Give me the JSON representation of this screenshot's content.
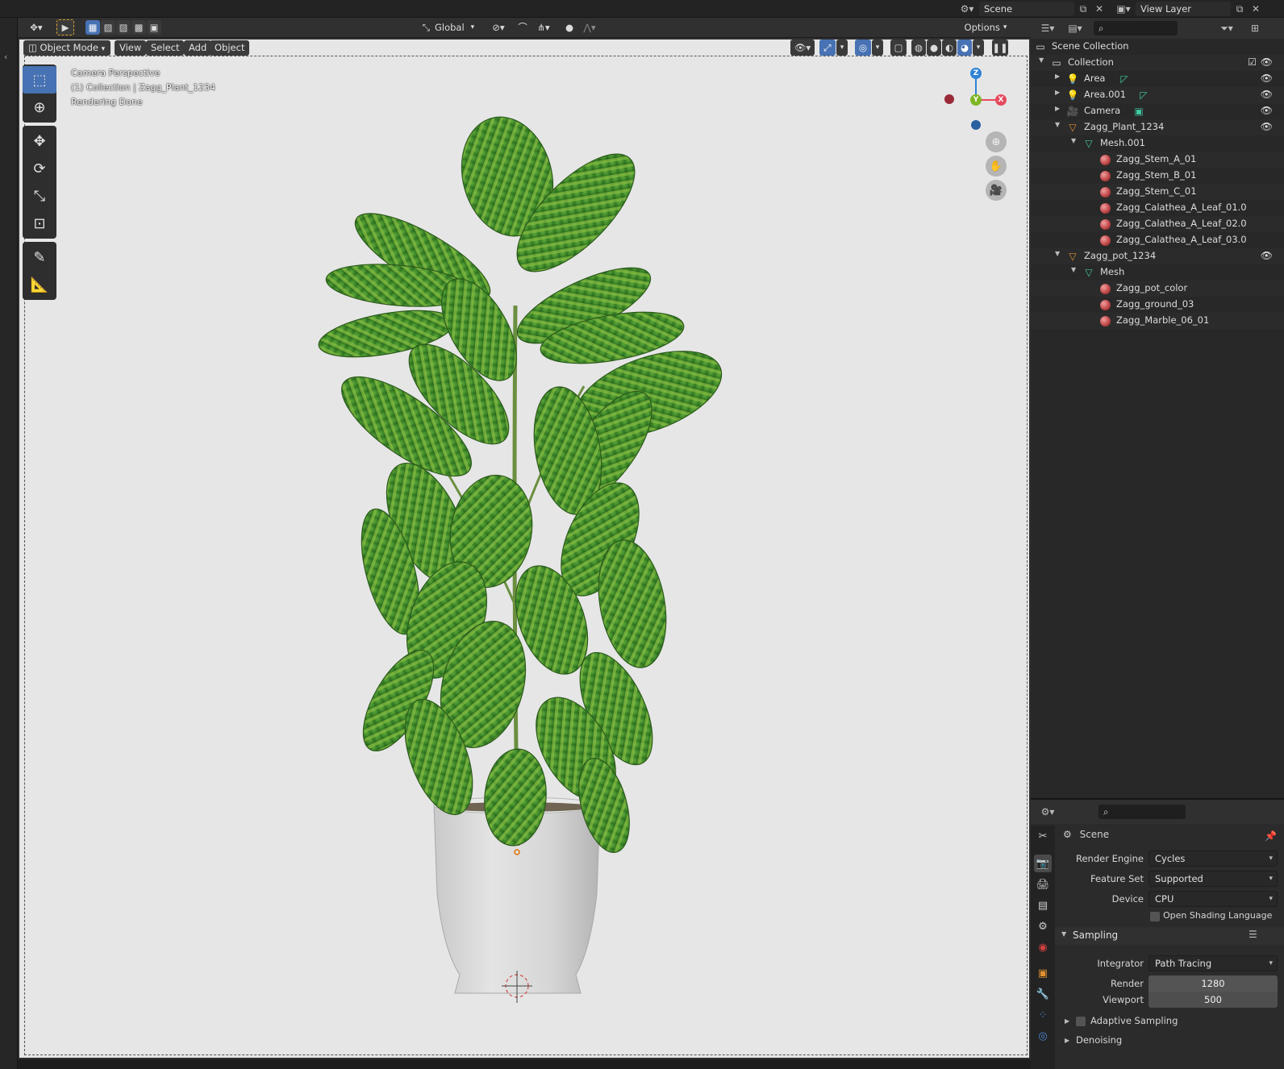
{
  "topbar": {
    "scene_name": "Scene",
    "view_layer_name": "View Layer"
  },
  "viewport_header": {
    "transform_orientation": "Global",
    "options_label": "Options"
  },
  "viewport_menu": {
    "mode": "Object Mode",
    "view": "View",
    "select": "Select",
    "add": "Add",
    "object": "Object"
  },
  "viewport_overlay": {
    "line1": "Camera Perspective",
    "line2": "(1) Collection | Zagg_Plant_1234",
    "line3": "Rendering Done"
  },
  "gizmo": {
    "x": "X",
    "y": "Y",
    "z": "Z",
    "x_color": "#e64a5c",
    "y_color": "#7fb623",
    "z_color": "#2f83d8"
  },
  "outliner": {
    "scene_collection": "Scene Collection",
    "items": [
      {
        "label": "Collection"
      },
      {
        "label": "Area"
      },
      {
        "label": "Area.001"
      },
      {
        "label": "Camera"
      },
      {
        "label": "Zagg_Plant_1234"
      },
      {
        "label": "Mesh.001"
      },
      {
        "label": "Zagg_Stem_A_01"
      },
      {
        "label": "Zagg_Stem_B_01"
      },
      {
        "label": "Zagg_Stem_C_01"
      },
      {
        "label": "Zagg_Calathea_A_Leaf_01.0"
      },
      {
        "label": "Zagg_Calathea_A_Leaf_02.0"
      },
      {
        "label": "Zagg_Calathea_A_Leaf_03.0"
      },
      {
        "label": "Zagg_pot_1234"
      },
      {
        "label": "Mesh"
      },
      {
        "label": "Zagg_pot_color"
      },
      {
        "label": "Zagg_ground_03"
      },
      {
        "label": "Zagg_Marble_06_01"
      }
    ]
  },
  "properties": {
    "context": "Scene",
    "render_engine_label": "Render Engine",
    "render_engine": "Cycles",
    "feature_set_label": "Feature Set",
    "feature_set": "Supported",
    "device_label": "Device",
    "device": "CPU",
    "osl_label": "Open Shading Language",
    "sampling_label": "Sampling",
    "integrator_label": "Integrator",
    "integrator": "Path Tracing",
    "render_label": "Render",
    "render_samples": "1280",
    "viewport_label": "Viewport",
    "viewport_samples": "500",
    "adaptive_label": "Adaptive Sampling",
    "denoising_label": "Denoising"
  },
  "colors": {
    "accent": "#4772b3",
    "viewport_bg": "#e6e6e6",
    "leaf_dark": "#2f6b23",
    "leaf_light": "#8cc43a"
  }
}
